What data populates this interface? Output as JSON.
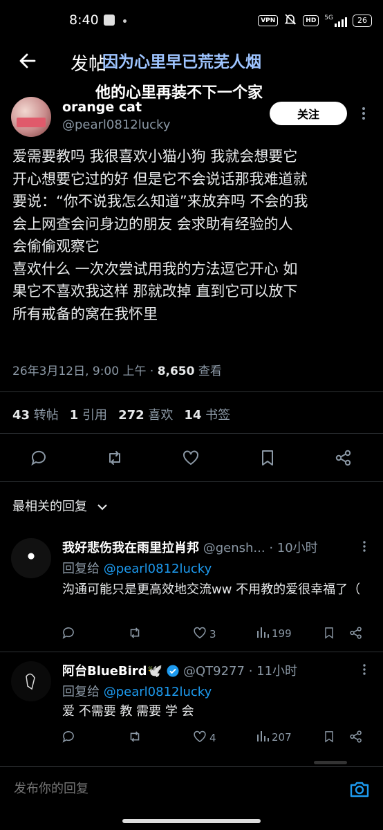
{
  "status_bar": {
    "time": "8:40",
    "vpn": "VPN",
    "hd": "HD",
    "network": "5G",
    "battery": "26"
  },
  "header": {
    "title": "发帖"
  },
  "overlay": {
    "line1": "因为心里早已荒芜人烟",
    "line2": "他的心里再装不下一个家"
  },
  "post": {
    "author_name": "orange cat",
    "author_handle": "@pearl0812lucky",
    "follow_label": "关注",
    "text": "爱需要教吗 我很喜欢小猫小狗 我就会想要它\n开心想要它过的好 但是它不会说话那我难道就\n要说：“你不说我怎么知道”来放弃吗 不会的我\n会上网查会问身边的朋友 会求助有经验的人\n会偷偷观察它\n喜欢什么 一次次尝试用我的方法逗它开心 如\n果它不喜欢我这样 那就改掉 直到它可以放下\n所有戒备的窝在我怀里",
    "timestamp": "26年3月12日, 9:00 上午 · ",
    "views_count": "8,650",
    "views_label": " 查看",
    "stats": {
      "reposts_count": "43",
      "reposts_label": "转帖",
      "quotes_count": "1",
      "quotes_label": "引用",
      "likes_count": "272",
      "likes_label": "喜欢",
      "bookmarks_count": "14",
      "bookmarks_label": "书签"
    }
  },
  "replies_sort": "最相关的回复",
  "replies": [
    {
      "name": "我好悲伤我在雨里拉肖邦",
      "handle": " @gensh...",
      "time": " · 10小时",
      "reply_to_label": "回复给 ",
      "reply_to_handle": "@pearl0812lucky",
      "text": "沟通可能只是更高效地交流ww 不用教的爱很幸福了（",
      "likes": "3",
      "views": "199"
    },
    {
      "name": "阿台BlueBird🕊️",
      "handle": " @QT9277",
      "time": " · 11小时",
      "reply_to_label": "回复给 ",
      "reply_to_handle": "@pearl0812lucky",
      "text": "爱 不需要 教 需要 学 会",
      "likes": "4",
      "views": "207"
    }
  ],
  "composer": {
    "placeholder": "发布你的回复"
  },
  "colors": {
    "background": "#000000",
    "link": "#1d9bf0",
    "muted": "#8b98a5",
    "verified": "#1d9bf0"
  }
}
